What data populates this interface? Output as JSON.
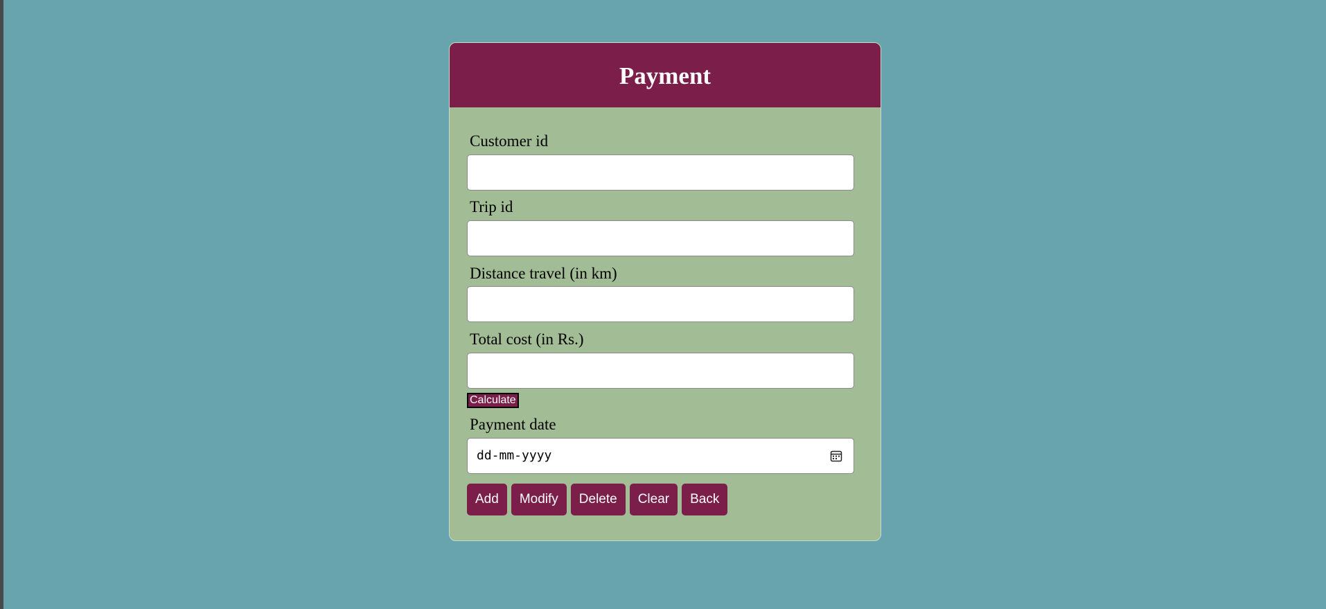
{
  "form": {
    "title": "Payment",
    "fields": [
      {
        "label": "Customer id",
        "value": ""
      },
      {
        "label": "Trip id",
        "value": ""
      },
      {
        "label": "Distance travel (in km)",
        "value": ""
      },
      {
        "label": "Total cost (in Rs.)",
        "value": ""
      }
    ],
    "calculate_label": "Calculate",
    "payment_date": {
      "label": "Payment date",
      "placeholder": "dd-mm-yyyy",
      "icon": "calendar-icon"
    },
    "actions": [
      "Add",
      "Modify",
      "Delete",
      "Clear",
      "Back"
    ]
  },
  "colors": {
    "page_background": "#67a4ae",
    "card_background": "#a2bc95",
    "accent": "#7b1e4a",
    "button_text": "#ffffff"
  }
}
